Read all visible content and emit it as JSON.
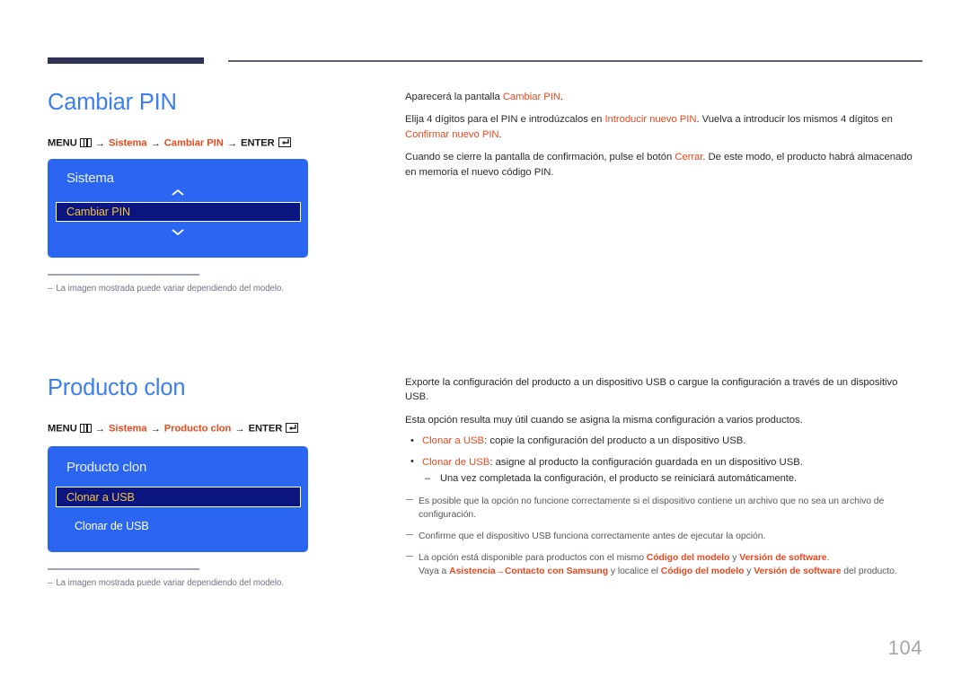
{
  "page": {
    "number": "104",
    "icons": {
      "menu": "menu-grid-icon",
      "enter": "enter-return-icon"
    }
  },
  "sections": [
    {
      "id": "cambiar-pin",
      "heading": "Cambiar PIN",
      "menu_path": {
        "menu_label": "MENU",
        "arrow": "→",
        "step1": "Sistema",
        "step2": "Cambiar PIN",
        "enter_label": "ENTER"
      },
      "osd": {
        "title": "Sistema",
        "up_chevron": "chevron-up-icon",
        "down_chevron": "chevron-down-icon",
        "selected_item": "Cambiar PIN"
      },
      "footnote": "La imagen mostrada puede variar dependiendo del modelo.",
      "footnote_dash": "–",
      "body": {
        "p1_a": "Aparecerá la pantalla ",
        "p1_accent": "Cambiar PIN",
        "p1_b": ".",
        "p2_a": "Elija 4 dígitos para el PIN e introdúzcalos en ",
        "p2_accent1": "Introducir nuevo PIN",
        "p2_b": ". Vuelva a introducir los mismos 4 dígitos en ",
        "p2_accent2": "Confirmar nuevo PIN",
        "p2_c": ".",
        "p3_a": "Cuando se cierre la pantalla de confirmación, pulse el botón ",
        "p3_accent": "Cerrar",
        "p3_b": ". De este modo, el producto habrá almacenado en memoria el nuevo código PIN."
      }
    },
    {
      "id": "producto-clon",
      "heading": "Producto clon",
      "menu_path": {
        "menu_label": "MENU",
        "arrow": "→",
        "step1": "Sistema",
        "step2": "Producto clon",
        "enter_label": "ENTER"
      },
      "osd": {
        "title": "Producto clon",
        "selected_item": "Clonar a USB",
        "item2": "Clonar de USB"
      },
      "footnote": "La imagen mostrada puede variar dependiendo del modelo.",
      "footnote_dash": "–",
      "body": {
        "p1": "Exporte la configuración del producto a un dispositivo USB o cargue la configuración a través de un dispositivo USB.",
        "p2": "Esta opción resulta muy útil cuando se asigna la misma configuración a varios productos.",
        "bullet1_accent": "Clonar a USB",
        "bullet1_text": ": copie la configuración del producto a un dispositivo USB.",
        "bullet2_accent": "Clonar de USB",
        "bullet2_text": ": asigne al producto la configuración guardada en un dispositivo USB.",
        "bullet2_sub": "Una vez completada la configuración, el producto se reiniciará automáticamente.",
        "note1": "Es posible que la opción no funcione correctamente si el dispositivo contiene un archivo que no sea un archivo de configuración.",
        "note2": "Confirme que el dispositivo USB funciona correctamente antes de ejecutar la opción.",
        "note3_a": "La opción está disponible para productos con el mismo ",
        "note3_accent1": "Código del modelo",
        "note3_b": " y ",
        "note3_accent2": "Versión de software",
        "note3_c": ".",
        "note3_d": "Vaya a ",
        "note3_accent3": "Asistencia",
        "note3_arrow": "→",
        "note3_accent4": "Contacto con Samsung",
        "note3_e": " y localice el ",
        "note3_accent5": "Código del modelo",
        "note3_f": " y ",
        "note3_accent6": "Versión de software",
        "note3_g": " del producto."
      }
    }
  ],
  "colors": {
    "heading_blue": "#3d7ef0",
    "accent_orange": "#e8491f",
    "osd_blue": "#2a66f2",
    "osd_selected_navy": "#0b1580",
    "osd_selected_text": "#f4c23a",
    "rule_navy": "#2e3355"
  }
}
